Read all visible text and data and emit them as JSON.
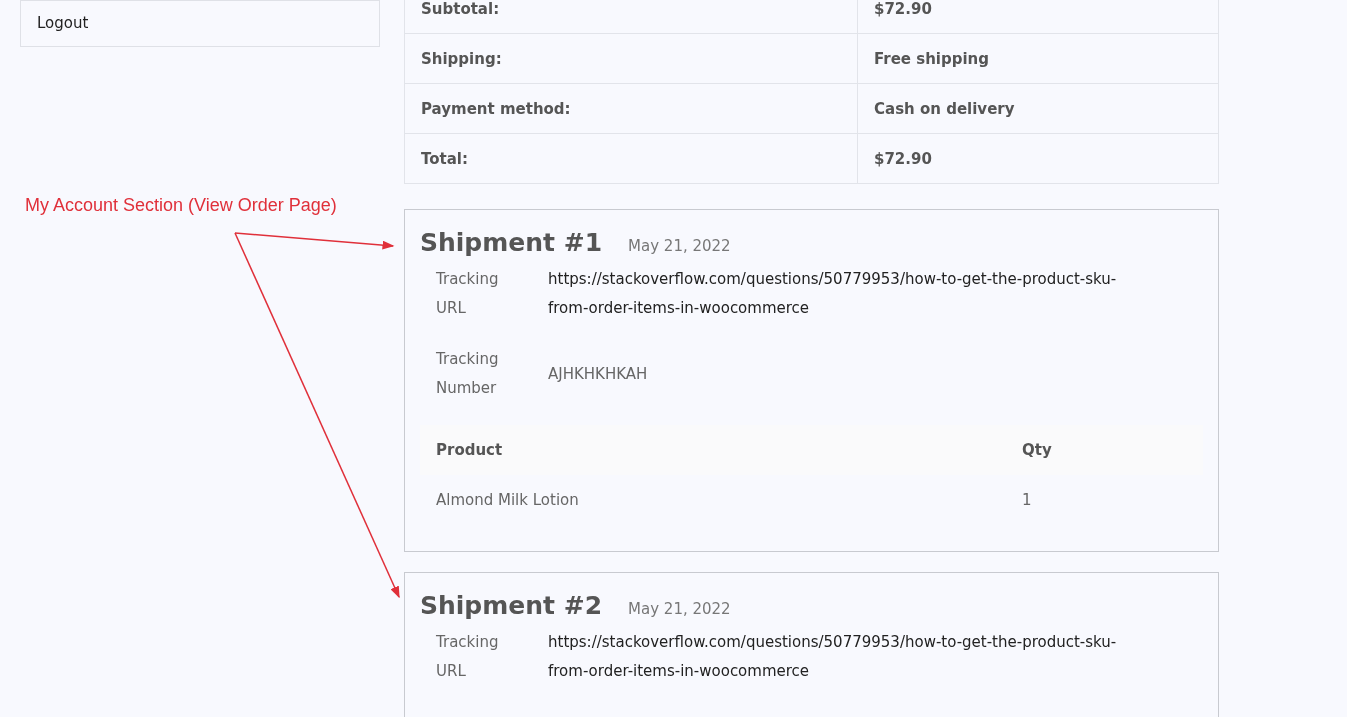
{
  "sidebar": {
    "items": [
      {
        "label": "Logout"
      }
    ]
  },
  "order_totals": [
    {
      "label": "Subtotal:",
      "value": "$72.90"
    },
    {
      "label": "Shipping:",
      "value": "Free shipping"
    },
    {
      "label": "Payment method:",
      "value": "Cash on delivery"
    },
    {
      "label": "Total:",
      "value": "$72.90"
    }
  ],
  "annotation": {
    "text": "My Account Section (View Order Page)"
  },
  "shipments": [
    {
      "title": "Shipment #1",
      "date": "May 21, 2022",
      "details": [
        {
          "label": "Tracking URL",
          "value": "https://stackoverflow.com/questions/50779953/how-to-get-the-product-sku-from-order-items-in-woocommerce",
          "kind": "link"
        },
        {
          "label": "Tracking Number",
          "value": "AJHKHKHKAH",
          "kind": "text"
        }
      ],
      "items_table": {
        "columns": [
          "Product",
          "Qty"
        ],
        "rows": [
          [
            "Almond Milk Lotion",
            "1"
          ]
        ]
      }
    },
    {
      "title": "Shipment #2",
      "date": "May 21, 2022",
      "details": [
        {
          "label": "Tracking URL",
          "value": "https://stackoverflow.com/questions/50779953/how-to-get-the-product-sku-from-order-items-in-woocommerce",
          "kind": "link"
        }
      ]
    }
  ]
}
